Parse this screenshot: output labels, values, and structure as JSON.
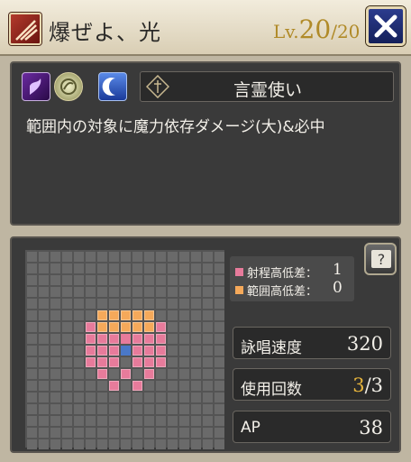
{
  "header": {
    "skill_name": "爆ぜよ、光",
    "level_prefix": "Lv.",
    "level_current": "20",
    "level_max": "/20",
    "icon": "flame-slash-icon",
    "close_icon": "close-icon"
  },
  "info": {
    "elements": [
      "dark-element-icon",
      "light-element-icon",
      "moon-element-icon"
    ],
    "job_emblem": "job-emblem-icon",
    "job_name": "言霊使い",
    "description": "範囲内の対象に魔力依存ダメージ(大)&必中"
  },
  "elevation": {
    "range_label": "射程高低差：",
    "range_value": "1",
    "area_label": "範囲高低差：",
    "area_value": "0",
    "range_color": "#e77b9b",
    "area_color": "#f5a95a"
  },
  "stats": {
    "cast_speed_label": "詠唱速度",
    "cast_speed_value": "320",
    "uses_label": "使用回数",
    "uses_current": "3",
    "uses_max": "/3",
    "ap_label": "AP",
    "ap_value": "38"
  },
  "colors": {
    "range": "#e77b9b",
    "area": "#f5a95a",
    "center": "#4a78c8",
    "gold": "#e6b43c"
  }
}
